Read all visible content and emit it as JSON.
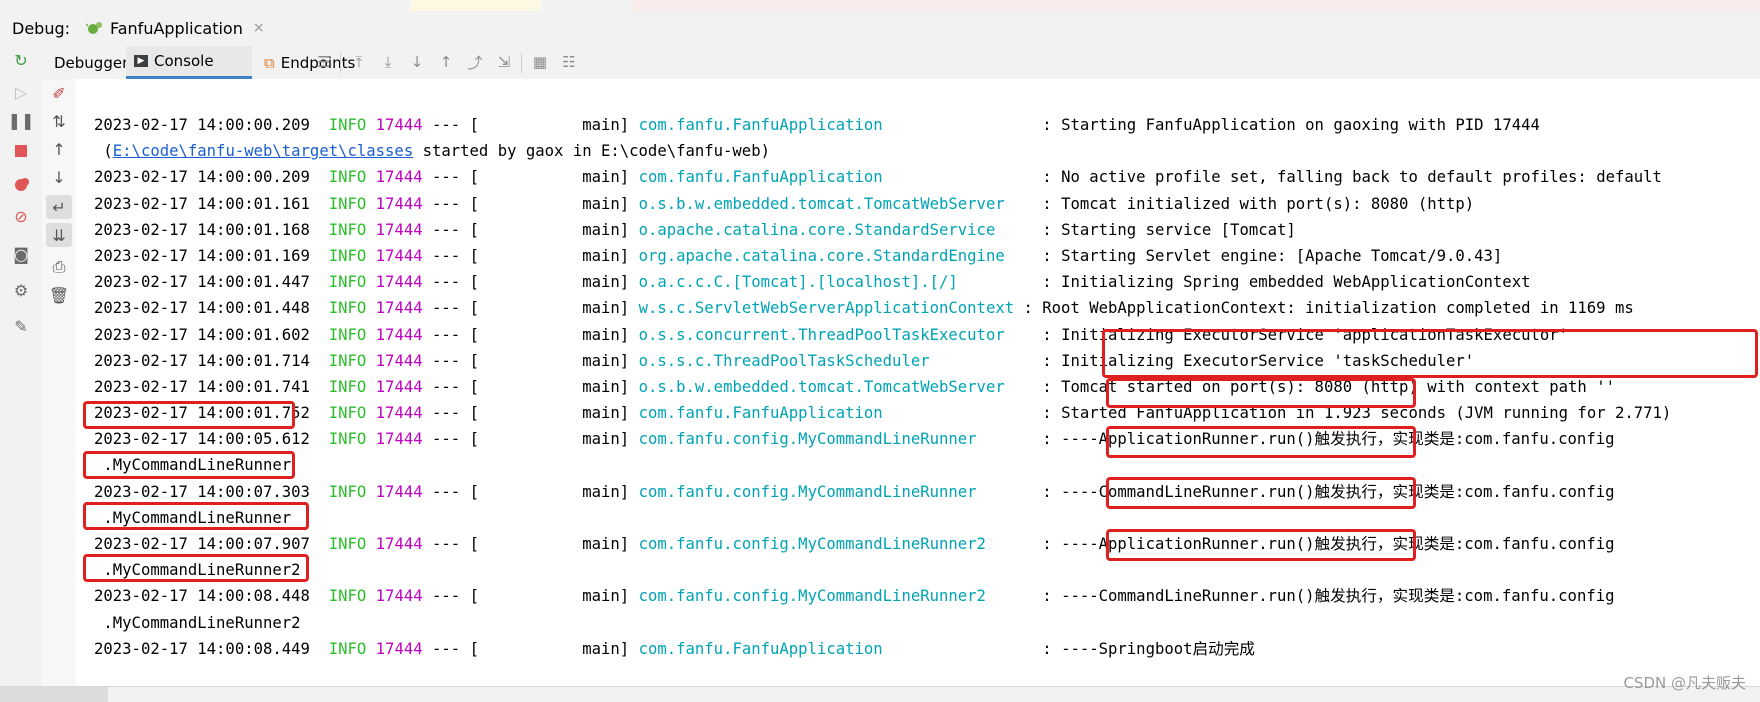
{
  "debug_bar": {
    "label": "Debug:",
    "run_tab": "FanfuApplication",
    "close": "×"
  },
  "toolbar": {
    "tabs": [
      "Debugger",
      "Console",
      "Endpoints"
    ],
    "active_tab": "Console"
  },
  "console": {
    "lines": [
      {
        "ts": "2023-02-17 14:00:00.209",
        "level": "INFO",
        "pid": "17444",
        "sep": " --- [",
        "thread": "           main]",
        "logger": "com.fanfu.FanfuApplication",
        "pad": "                 ",
        "msg": ": Starting FanfuApplication on gaoxing with PID 17444"
      },
      {
        "cont_pre": " (",
        "link": "E:\\code\\fanfu-web\\target\\classes",
        "cont_post": " started by gaox in E:\\code\\fanfu-web)"
      },
      {
        "ts": "2023-02-17 14:00:00.209",
        "level": "INFO",
        "pid": "17444",
        "sep": " --- [",
        "thread": "           main]",
        "logger": "com.fanfu.FanfuApplication",
        "pad": "                 ",
        "msg": ": No active profile set, falling back to default profiles: default"
      },
      {
        "ts": "2023-02-17 14:00:01.161",
        "level": "INFO",
        "pid": "17444",
        "sep": " --- [",
        "thread": "           main]",
        "logger": "o.s.b.w.embedded.tomcat.TomcatWebServer",
        "pad": "    ",
        "msg": ": Tomcat initialized with port(s): 8080 (http)"
      },
      {
        "ts": "2023-02-17 14:00:01.168",
        "level": "INFO",
        "pid": "17444",
        "sep": " --- [",
        "thread": "           main]",
        "logger": "o.apache.catalina.core.StandardService",
        "pad": "     ",
        "msg": ": Starting service [Tomcat]"
      },
      {
        "ts": "2023-02-17 14:00:01.169",
        "level": "INFO",
        "pid": "17444",
        "sep": " --- [",
        "thread": "           main]",
        "logger": "org.apache.catalina.core.StandardEngine",
        "pad": "    ",
        "msg": ": Starting Servlet engine: [Apache Tomcat/9.0.43]"
      },
      {
        "ts": "2023-02-17 14:00:01.447",
        "level": "INFO",
        "pid": "17444",
        "sep": " --- [",
        "thread": "           main]",
        "logger": "o.a.c.c.C.[Tomcat].[localhost].[/]",
        "pad": "         ",
        "msg": ": Initializing Spring embedded WebApplicationContext"
      },
      {
        "ts": "2023-02-17 14:00:01.448",
        "level": "INFO",
        "pid": "17444",
        "sep": " --- [",
        "thread": "           main]",
        "logger": "w.s.c.ServletWebServerApplicationContext",
        "pad": " ",
        "msg": ": Root WebApplicationContext: initialization completed in 1169 ms"
      },
      {
        "ts": "2023-02-17 14:00:01.602",
        "level": "INFO",
        "pid": "17444",
        "sep": " --- [",
        "thread": "           main]",
        "logger": "o.s.s.concurrent.ThreadPoolTaskExecutor",
        "pad": "    ",
        "msg": ": Initializing ExecutorService 'applicationTaskExecutor'"
      },
      {
        "ts": "2023-02-17 14:00:01.714",
        "level": "INFO",
        "pid": "17444",
        "sep": " --- [",
        "thread": "           main]",
        "logger": "o.s.s.c.ThreadPoolTaskScheduler",
        "pad": "            ",
        "msg": ": Initializing ExecutorService 'taskScheduler'"
      },
      {
        "ts": "2023-02-17 14:00:01.741",
        "level": "INFO",
        "pid": "17444",
        "sep": " --- [",
        "thread": "           main]",
        "logger": "o.s.b.w.embedded.tomcat.TomcatWebServer",
        "pad": "    ",
        "msg": ": Tomcat started on port(s): 8080 (http) with context path ''"
      },
      {
        "ts": "2023-02-17 14:00:01.752",
        "level": "INFO",
        "pid": "17444",
        "sep": " --- [",
        "thread": "           main]",
        "logger": "com.fanfu.FanfuApplication",
        "pad": "                 ",
        "msg": ": Started FanfuApplication in 1.923 seconds (JVM running for 2.771)"
      },
      {
        "ts": "2023-02-17 14:00:05.612",
        "level": "INFO",
        "pid": "17444",
        "sep": " --- [",
        "thread": "           main]",
        "logger": "com.fanfu.config.MyCommandLineRunner",
        "pad": "       ",
        "msg": ": ----ApplicationRunner.run()触发执行，实现类是:com.fanfu.config"
      },
      {
        "cont_pre": " .MyCommandLineRunner"
      },
      {
        "ts": "2023-02-17 14:00:07.303",
        "level": "INFO",
        "pid": "17444",
        "sep": " --- [",
        "thread": "           main]",
        "logger": "com.fanfu.config.MyCommandLineRunner",
        "pad": "       ",
        "msg": ": ----CommandLineRunner.run()触发执行，实现类是:com.fanfu.config"
      },
      {
        "cont_pre": " .MyCommandLineRunner"
      },
      {
        "ts": "2023-02-17 14:00:07.907",
        "level": "INFO",
        "pid": "17444",
        "sep": " --- [",
        "thread": "           main]",
        "logger": "com.fanfu.config.MyCommandLineRunner2",
        "pad": "      ",
        "msg": ": ----ApplicationRunner.run()触发执行，实现类是:com.fanfu.config"
      },
      {
        "cont_pre": " .MyCommandLineRunner2"
      },
      {
        "ts": "2023-02-17 14:00:08.448",
        "level": "INFO",
        "pid": "17444",
        "sep": " --- [",
        "thread": "           main]",
        "logger": "com.fanfu.config.MyCommandLineRunner2",
        "pad": "      ",
        "msg": ": ----CommandLineRunner.run()触发执行，实现类是:com.fanfu.config"
      },
      {
        "cont_pre": " .MyCommandLineRunner2"
      },
      {
        "ts": "2023-02-17 14:00:08.449",
        "level": "INFO",
        "pid": "17444",
        "sep": " --- [",
        "thread": "           main]",
        "logger": "com.fanfu.FanfuApplication",
        "pad": "                 ",
        "msg": ": ----Springboot启动完成"
      }
    ]
  },
  "watermark": "CSDN @凡夫贩夫",
  "colors": {
    "level": "#2bbf2b",
    "pid": "#c000c0",
    "logger": "#00a3b5",
    "highlight": "#e02020"
  }
}
